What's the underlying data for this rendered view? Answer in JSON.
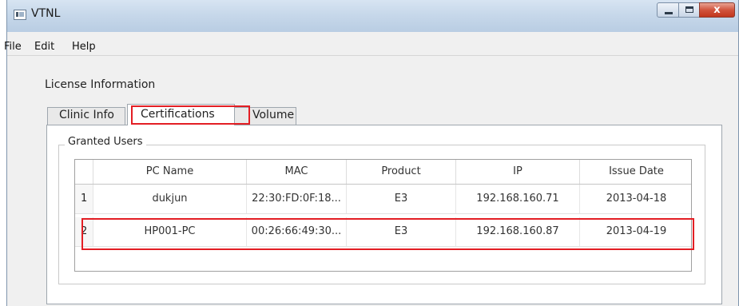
{
  "window": {
    "title": "VTNL"
  },
  "title_bar_buttons": {
    "close_glyph": "x"
  },
  "menu": {
    "items": [
      "File",
      "Edit",
      "Help"
    ]
  },
  "license_section": {
    "label": "License Information",
    "tabs": [
      "Clinic Info",
      "Certifications",
      "Volume"
    ],
    "selected_tab": "Certifications"
  },
  "granted_users": {
    "label": "Granted Users",
    "columns": [
      "PC Name",
      "MAC",
      "Product",
      "IP",
      "Issue Date"
    ],
    "rows": [
      {
        "num": "1",
        "pc_name": "dukjun",
        "mac": "22:30:FD:0F:18...",
        "product": "E3",
        "ip": "192.168.160.71",
        "issue_date": "2013-04-18"
      },
      {
        "num": "2",
        "pc_name": "HP001-PC",
        "mac": "00:26:66:49:30...",
        "product": "E3",
        "ip": "192.168.160.87",
        "issue_date": "2013-04-19"
      }
    ]
  },
  "colors": {
    "highlight": "#e31e24",
    "titlebar": "#c7d8ea",
    "close_button": "#d1543d"
  }
}
